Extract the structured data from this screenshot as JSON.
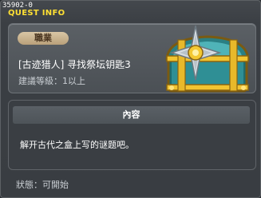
{
  "window": {
    "quest_id": "35902-0",
    "title": "QUEST INFO"
  },
  "quest": {
    "job_badge": "職業",
    "name": "[古迹猎人] 寻找祭坛钥匙3",
    "level_requirement": "建議等級：1以上",
    "icon": "treasure-chest-icon"
  },
  "content": {
    "header": "內容",
    "description": "解开古代之盒上写的谜题吧。"
  },
  "status": {
    "text": "狀態：可開始"
  },
  "colors": {
    "title": "#ffe033",
    "badge": "#cbb590",
    "panel": "#50555a"
  }
}
